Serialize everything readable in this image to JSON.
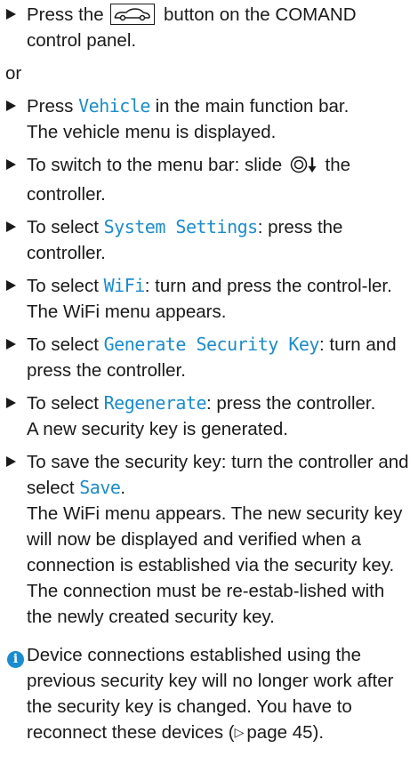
{
  "step1": {
    "before": "Press the",
    "icon": "vehicle-button-icon",
    "after": "button on the COMAND control panel."
  },
  "or_label": "or",
  "step2": {
    "pre": "Press ",
    "kw": "Vehicle",
    "post": " in the main function bar.",
    "result": "The vehicle menu is displayed."
  },
  "step3": {
    "pre": "To switch to the menu bar: slide",
    "icon": "controller-slide-down-icon",
    "post": "the controller."
  },
  "step4": {
    "pre": "To select ",
    "kw": "System Settings",
    "post": ": press the controller."
  },
  "step5": {
    "pre": "To select ",
    "kw": "WiFi",
    "post": ": turn and press the control-ler.",
    "result": "The WiFi menu appears."
  },
  "step6": {
    "pre": "To select ",
    "kw": "Generate Security Key",
    "post": ": turn and press the controller."
  },
  "step7": {
    "pre": "To select ",
    "kw": "Regenerate",
    "post": ": press the controller.",
    "result": "A new security key is generated."
  },
  "step8": {
    "pre": "To save the security key: turn the controller and select ",
    "kw": "Save",
    "post": ".",
    "result": "The WiFi menu appears. The new security key will now be displayed and verified when a connection is established via the security key. The connection must be re-estab-lished with the newly created security key."
  },
  "note": {
    "icon": "info-icon",
    "icon_glyph": "i",
    "text": "Device connections established using the previous security key will no longer work after the security key is changed. You have to reconnect these devices (",
    "page_ref_symbol": "▷",
    "page_ref": "page 45",
    "text_end": ")."
  },
  "colors": {
    "keyword": "#1a8cd0",
    "info_icon": "#1a8cd0",
    "text": "#1a1a1a"
  }
}
